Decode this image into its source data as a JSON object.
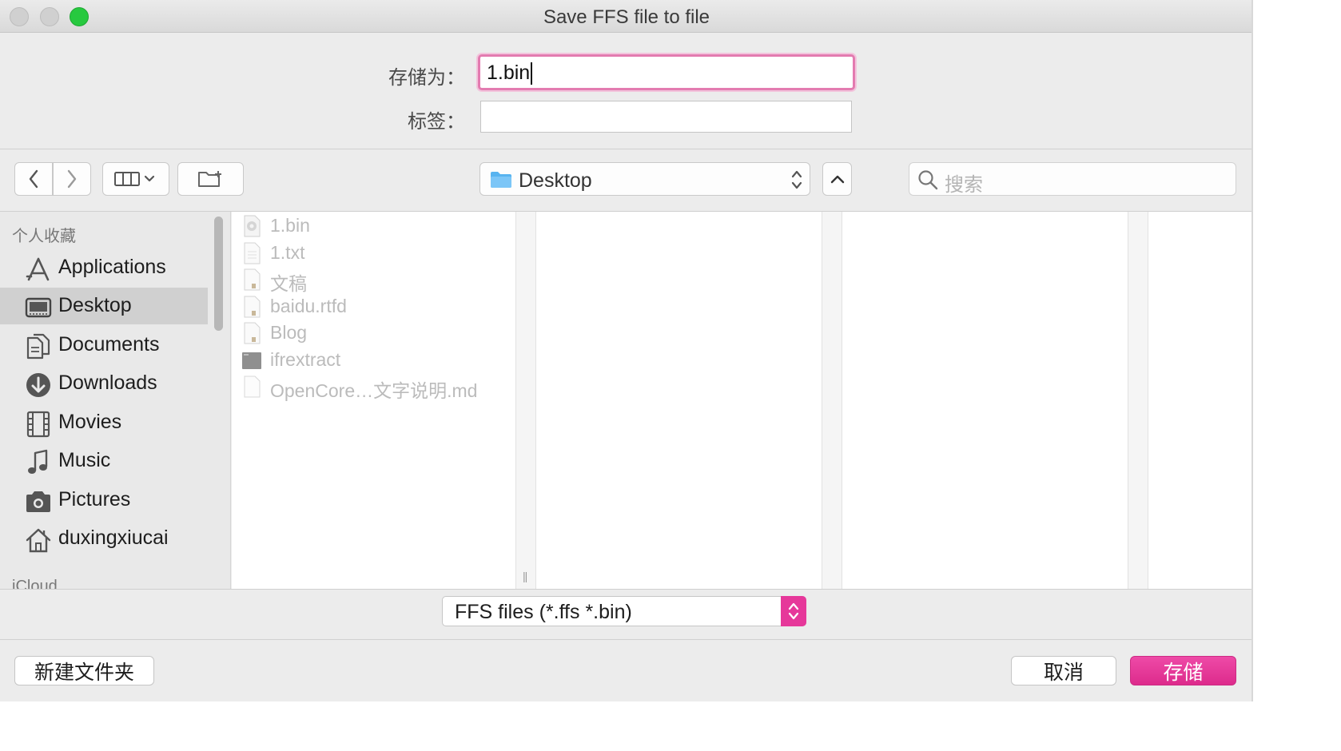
{
  "window": {
    "title": "Save FFS file to file"
  },
  "save_as": {
    "label": "存储为：",
    "value": "1.bin",
    "tags_label": "标签："
  },
  "toolbar": {
    "path_label": "Desktop",
    "search_placeholder": "搜索"
  },
  "sidebar": {
    "section_favorites": "个人收藏",
    "items": [
      {
        "label": "Applications",
        "icon": "applications-icon"
      },
      {
        "label": "Desktop",
        "icon": "desktop-icon",
        "selected": true
      },
      {
        "label": "Documents",
        "icon": "documents-icon"
      },
      {
        "label": "Downloads",
        "icon": "downloads-icon"
      },
      {
        "label": "Movies",
        "icon": "movies-icon"
      },
      {
        "label": "Music",
        "icon": "music-icon"
      },
      {
        "label": "Pictures",
        "icon": "pictures-icon"
      },
      {
        "label": "duxingxiucai",
        "icon": "home-icon"
      }
    ],
    "section_icloud": "iCloud"
  },
  "files": [
    {
      "name": "1.bin",
      "icon": "binary-file-icon"
    },
    {
      "name": "1.txt",
      "icon": "text-file-icon"
    },
    {
      "name": "文稿",
      "icon": "document-file-icon"
    },
    {
      "name": "baidu.rtfd",
      "icon": "rtfd-file-icon"
    },
    {
      "name": "Blog",
      "icon": "document-file-icon"
    },
    {
      "name": "ifrextract",
      "icon": "executable-file-icon"
    },
    {
      "name": "OpenCore…文字说明.md",
      "icon": "blank-file-icon"
    }
  ],
  "format": {
    "label": "FFS files (*.ffs *.bin)"
  },
  "buttons": {
    "new_folder": "新建文件夹",
    "cancel": "取消",
    "save": "存储"
  },
  "colors": {
    "accent": "#e6389a",
    "focus_ring": "#e37bb0",
    "sidebar_selected": "#d0d0d0",
    "disabled_text": "#bbbbbb"
  }
}
